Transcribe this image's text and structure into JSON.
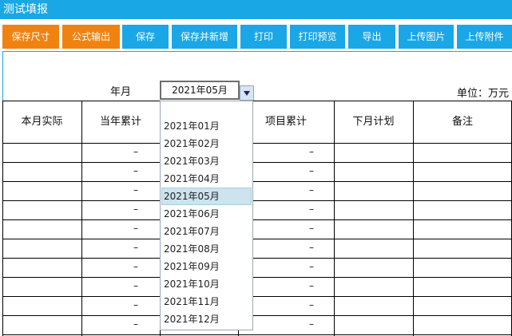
{
  "window": {
    "title": "测试填报"
  },
  "toolbar": {
    "buttons": [
      {
        "label": "保存尺寸",
        "color": "#f08310"
      },
      {
        "label": "公式输出",
        "color": "#f08310"
      },
      {
        "label": "保存",
        "color": "#1aa7e6"
      },
      {
        "label": "保存并新增",
        "color": "#1aa7e6"
      },
      {
        "label": "打印",
        "color": "#1aa7e6"
      },
      {
        "label": "打印预览",
        "color": "#1aa7e6"
      },
      {
        "label": "导出",
        "color": "#1aa7e6"
      },
      {
        "label": "上传图片",
        "color": "#1aa7e6"
      },
      {
        "label": "上传附件",
        "color": "#1aa7e6"
      }
    ]
  },
  "form": {
    "month_label": "年月",
    "month_value": "2021年05月",
    "unit_label": "单位：万元"
  },
  "table": {
    "headers": [
      "本月实际",
      "当年累计",
      "",
      "项目累计",
      "下月计划",
      "备注"
    ],
    "dash": "–",
    "rows": 10
  },
  "dropdown": {
    "options": [
      "2021年01月",
      "2021年02月",
      "2021年03月",
      "2021年04月",
      "2021年05月",
      "2021年06月",
      "2021年07月",
      "2021年08月",
      "2021年09月",
      "2021年10月",
      "2021年11月",
      "2021年12月"
    ],
    "selected_index": 4
  },
  "colors": {
    "accent": "#1aa7e6",
    "orange": "#f08310",
    "selected_option_bg": "#cde3ee"
  }
}
